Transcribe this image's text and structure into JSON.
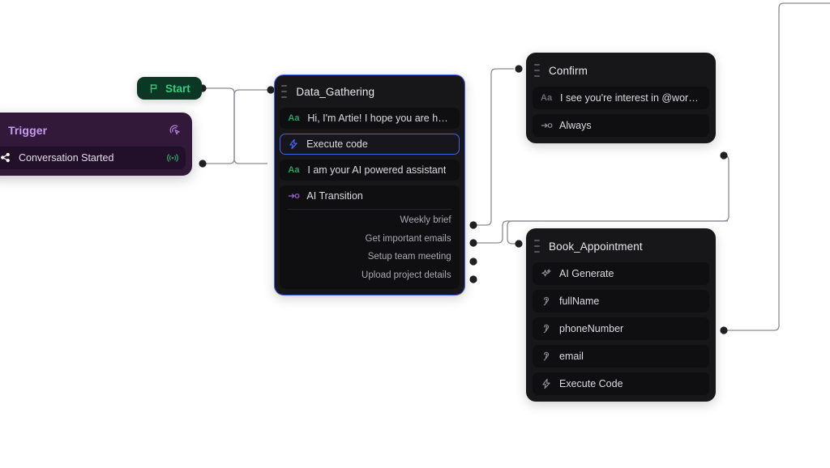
{
  "canvas": {
    "background": "#ffffff"
  },
  "colors": {
    "node_bg": "#17171a",
    "row_bg": "#0f0f11",
    "selection_blue": "#4763e4",
    "trigger_purple": "#32193a",
    "trigger_title": "#c79bf0",
    "start_green_bg": "#0c3725",
    "start_green_text": "#37c97f",
    "edge": "#8a8a92",
    "dot": "#202024"
  },
  "start_button": {
    "label": "Start",
    "icon": "flag-icon"
  },
  "trigger_node": {
    "title": "Trigger",
    "handle_icon": "drag-handle-icon",
    "header_icon": "cursor-click-icon",
    "rows": [
      {
        "label": "Conversation Started",
        "icon": "share-nodes-icon",
        "trailing_icon": "broadcast-icon"
      }
    ]
  },
  "data_gathering_node": {
    "title": "Data_Gathering",
    "handle_icon": "drag-handle-icon",
    "selected": true,
    "rows": [
      {
        "label": "Hi, I'm Artie! I hope you are havi…",
        "icon": "aa-text-icon",
        "icon_color": "green"
      },
      {
        "label": "Execute code",
        "icon": "lightning-icon",
        "icon_color": "blue",
        "highlight": true
      },
      {
        "label": "I am your AI powered assistant",
        "icon": "aa-text-icon",
        "icon_color": "green"
      },
      {
        "label": "AI Transition",
        "icon": "transition-arrow-icon",
        "icon_color": "purple"
      }
    ],
    "transitions": [
      "Weekly brief",
      "Get important emails",
      "Setup team meeting",
      "Upload project details"
    ]
  },
  "confirm_node": {
    "title": "Confirm",
    "handle_icon": "drag-handle-icon",
    "rows": [
      {
        "label": "I see you're interest in @workfl…",
        "icon": "aa-text-icon",
        "icon_color": "grey"
      },
      {
        "label": "Always",
        "icon": "transition-arrow-icon",
        "icon_color": "grey"
      }
    ]
  },
  "book_appointment_node": {
    "title": "Book_Appointment",
    "handle_icon": "drag-handle-icon",
    "rows": [
      {
        "label": "AI Generate",
        "icon": "sparkle-icon"
      },
      {
        "label": "fullName",
        "icon": "listen-ear-icon"
      },
      {
        "label": "phoneNumber",
        "icon": "listen-ear-icon"
      },
      {
        "label": "email",
        "icon": "listen-ear-icon"
      },
      {
        "label": "Execute Code",
        "icon": "lightning-icon"
      }
    ]
  },
  "edges": [
    {
      "name": "start-to-data-gathering"
    },
    {
      "name": "trigger-to-data-gathering"
    },
    {
      "name": "weekly-brief-to-confirm"
    },
    {
      "name": "get-important-emails-to-book-appointment"
    },
    {
      "name": "confirm-to-book-appointment"
    },
    {
      "name": "book-appointment-to-offscreen"
    }
  ]
}
